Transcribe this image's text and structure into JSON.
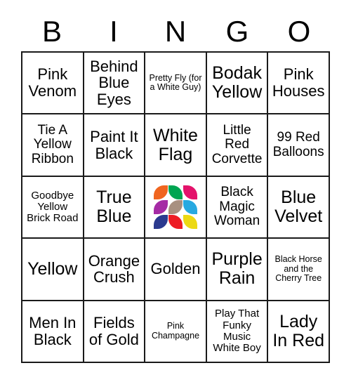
{
  "header": {
    "letters": [
      "B",
      "I",
      "N",
      "G",
      "O"
    ]
  },
  "grid": {
    "rows": [
      [
        {
          "text": "Pink Venom",
          "size": "lg"
        },
        {
          "text": "Behind Blue Eyes",
          "size": "lg"
        },
        {
          "text": "Pretty Fly (for a White Guy)",
          "size": "xs"
        },
        {
          "text": "Bodak Yellow",
          "size": "xl"
        },
        {
          "text": "Pink Houses",
          "size": "lg"
        }
      ],
      [
        {
          "text": "Tie A Yellow Ribbon",
          "size": "md"
        },
        {
          "text": "Paint It Black",
          "size": "lg"
        },
        {
          "text": "White Flag",
          "size": "xl"
        },
        {
          "text": "Little Red Corvette",
          "size": "md"
        },
        {
          "text": "99 Red Balloons",
          "size": "md"
        }
      ],
      [
        {
          "text": "Goodbye Yellow Brick Road",
          "size": "sm"
        },
        {
          "text": "True Blue",
          "size": "xl"
        },
        {
          "text": "",
          "size": "md",
          "free_space": true
        },
        {
          "text": "Black Magic Woman",
          "size": "md"
        },
        {
          "text": "Blue Velvet",
          "size": "xl"
        }
      ],
      [
        {
          "text": "Yellow",
          "size": "xl"
        },
        {
          "text": "Orange Crush",
          "size": "lg"
        },
        {
          "text": "Golden",
          "size": "lg"
        },
        {
          "text": "Purple Rain",
          "size": "xl"
        },
        {
          "text": "Black Horse and the Cherry Tree",
          "size": "xs"
        }
      ],
      [
        {
          "text": "Men In Black",
          "size": "lg"
        },
        {
          "text": "Fields of Gold",
          "size": "lg"
        },
        {
          "text": "Pink Champagne",
          "size": "xs"
        },
        {
          "text": "Play That Funky Music White Boy",
          "size": "sm"
        },
        {
          "text": "Lady In Red",
          "size": "xl"
        }
      ]
    ]
  },
  "free_space_logo": {
    "name": "free-space-logo",
    "tiles": [
      {
        "color": "#f0651f",
        "shape": "leaf-a"
      },
      {
        "color": "#00a551",
        "shape": "leaf-b"
      },
      {
        "color": "#e4126b",
        "shape": "leaf-b"
      },
      {
        "color": "#a52ba5",
        "shape": "leaf-a"
      },
      {
        "color": "#a89080",
        "shape": "leaf-a"
      },
      {
        "color": "#27a9e1",
        "shape": "leaf-b"
      },
      {
        "color": "#2b3a8f",
        "shape": "leaf-a"
      },
      {
        "color": "#ed1c24",
        "shape": "leaf-b"
      },
      {
        "color": "#ecd914",
        "shape": "leaf-b"
      }
    ]
  },
  "colors": {
    "border": "#1a1a1a",
    "text": "#000000",
    "background": "#ffffff"
  }
}
